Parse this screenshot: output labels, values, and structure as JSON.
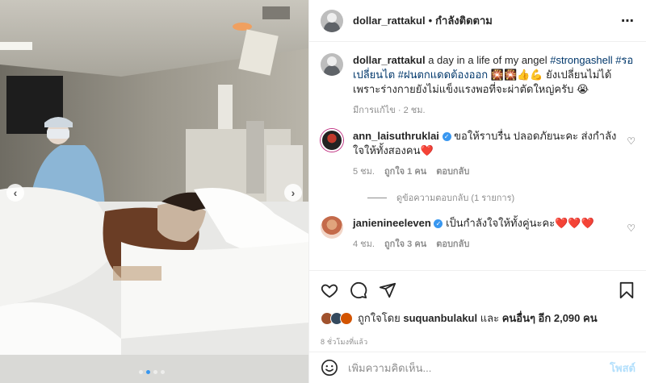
{
  "post": {
    "author": "dollar_rattakul",
    "follow_status": "กำลังติดตาม",
    "caption_text": "a day in a life of my angel",
    "caption_tags_1": "#strongashell #รอเปลี่ยนไต #ฝนตกแดดต้องออก",
    "caption_rest": "🎇🎇👍💪 ยังเปลี่ยนไม่ได้ เพราะร่างกายยังไม่แข็งแรงพอที่จะผ่าตัดใหญ่ครับ 😭",
    "edited_time": "มีการแก้ไข · 2 ชม."
  },
  "comments": [
    {
      "username": "ann_laisuthruklai",
      "text": "ขอให้ราบรื่น ปลอดภัยนะคะ ส่งกำลังใจให้ทั้งสองคน❤️",
      "time": "5 ชม.",
      "likes": "ถูกใจ 1 คน",
      "reply": "ตอบกลับ",
      "view_replies": "ดูข้อความตอบกลับ (1 รายการ)"
    },
    {
      "username": "janienineeleven",
      "text": "เป็นกำลังใจให้ทั้งคู่นะคะ❤️❤️❤️",
      "time": "4 ชม.",
      "likes": "ถูกใจ 3 คน",
      "reply": "ตอบกลับ"
    }
  ],
  "likes_line": {
    "prefix": "ถูกใจโดย",
    "user": "suquanbulakul",
    "middle": "และ",
    "others": "คนอื่นๆ อีก 2,090 คน"
  },
  "posted_ago": "8 ชั่วโมงที่แล้ว",
  "comment_input": {
    "placeholder": "เพิ่มความคิดเห็น...",
    "post_label": "โพสต์"
  },
  "carousel": {
    "total": 4,
    "current": 2
  },
  "colors": {
    "link": "#00376b",
    "accent": "#3897f0",
    "heart": "#ed4956"
  },
  "icons": [
    "more-icon",
    "heart-icon",
    "comment-icon",
    "share-icon",
    "bookmark-icon",
    "emoji-icon",
    "verified-icon"
  ]
}
